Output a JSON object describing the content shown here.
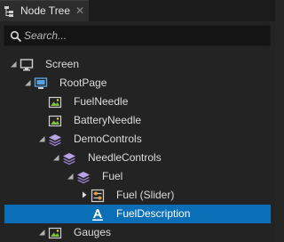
{
  "tab": {
    "title": "Node Tree",
    "close_glyph": "✕",
    "icon": "node-tree-icon"
  },
  "search": {
    "placeholder": "Search...",
    "icon": "search-icon"
  },
  "tree": [
    {
      "label": "Screen",
      "icon": "screen-icon",
      "toggle": "expanded",
      "selected": false
    },
    {
      "label": "RootPage",
      "icon": "page-icon",
      "toggle": "expanded",
      "selected": false
    },
    {
      "label": "FuelNeedle",
      "icon": "image-icon",
      "toggle": "none",
      "selected": false
    },
    {
      "label": "BatteryNeedle",
      "icon": "image-icon",
      "toggle": "none",
      "selected": false
    },
    {
      "label": "DemoControls",
      "icon": "layers-icon",
      "toggle": "expanded",
      "selected": false
    },
    {
      "label": "NeedleControls",
      "icon": "layers-icon",
      "toggle": "expanded",
      "selected": false
    },
    {
      "label": "Fuel",
      "icon": "layers-icon",
      "toggle": "expanded",
      "selected": false
    },
    {
      "label": "Fuel (Slider)",
      "icon": "slider-icon",
      "toggle": "collapsed",
      "selected": false
    },
    {
      "label": "FuelDescription",
      "icon": "text-block-icon",
      "toggle": "none",
      "selected": true
    },
    {
      "label": "Gauges",
      "icon": "image-icon",
      "toggle": "expanded",
      "selected": false
    }
  ],
  "colors": {
    "background": "#232323",
    "selection": "#0b6fb8",
    "image_icon": "#7fbf3f",
    "text": "#dcdcdc"
  }
}
